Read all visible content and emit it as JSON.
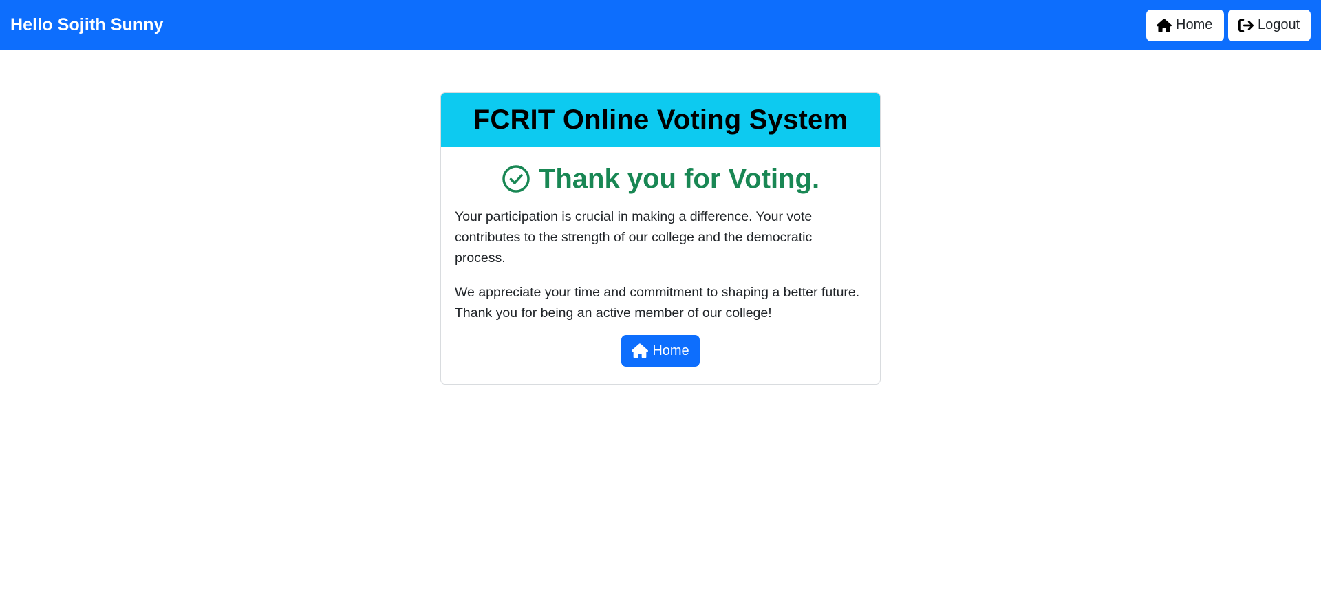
{
  "navbar": {
    "greeting": "Hello Sojith Sunny",
    "home_label": "Home",
    "logout_label": "Logout"
  },
  "card": {
    "title": "FCRIT Online Voting System",
    "thanks": "Thank you for Voting.",
    "paragraph_1": "Your participation is crucial in making a difference. Your vote contributes to the strength of our college and the democratic process.",
    "paragraph_2": "We appreciate your time and commitment to shaping a better future. Thank you for being an active member of our college!",
    "home_button_label": "Home"
  },
  "colors": {
    "navbar_bg": "#0d6efd",
    "card_header_bg": "#0dcaf0",
    "success_text": "#198754",
    "primary_button": "#0d6efd"
  },
  "icons": {
    "nav_home": "house-icon",
    "nav_logout": "logout-icon",
    "thanks": "check-circle-icon",
    "button_home": "house-icon"
  }
}
